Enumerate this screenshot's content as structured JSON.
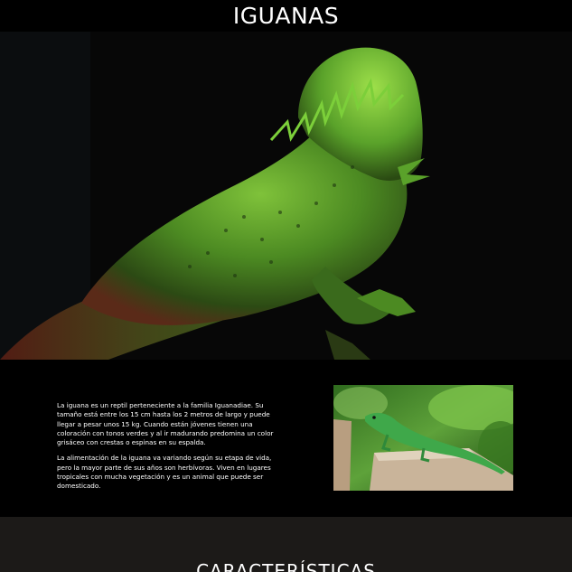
{
  "header": {
    "title": "IGUANAS"
  },
  "hero": {
    "image_alt": "iguana-photo"
  },
  "content": {
    "paragraphs": [
      "La iguana es un reptil perteneciente a la familia Iguanadiae. Su tamaño está entre los 15 cm hasta los 2 metros de largo y puede llegar a pesar unos 15 kg. Cuando están jóvenes tienen una coloración con tonos verdes y al ir madurando predomina un color grisáceo con crestas o espinas en su espalda.",
      "La alimentación de la iguana va variando según su etapa de vida, pero la mayor parte de sus años son herbívoras. Viven en lugares tropicales con mucha vegetación y es un animal que puede ser domesticado."
    ]
  },
  "section": {
    "title": "CARACTERÍSTICAS"
  },
  "colors": {
    "background": "#000000",
    "footer_bg": "#1c1a18",
    "text": "#ffffff"
  }
}
